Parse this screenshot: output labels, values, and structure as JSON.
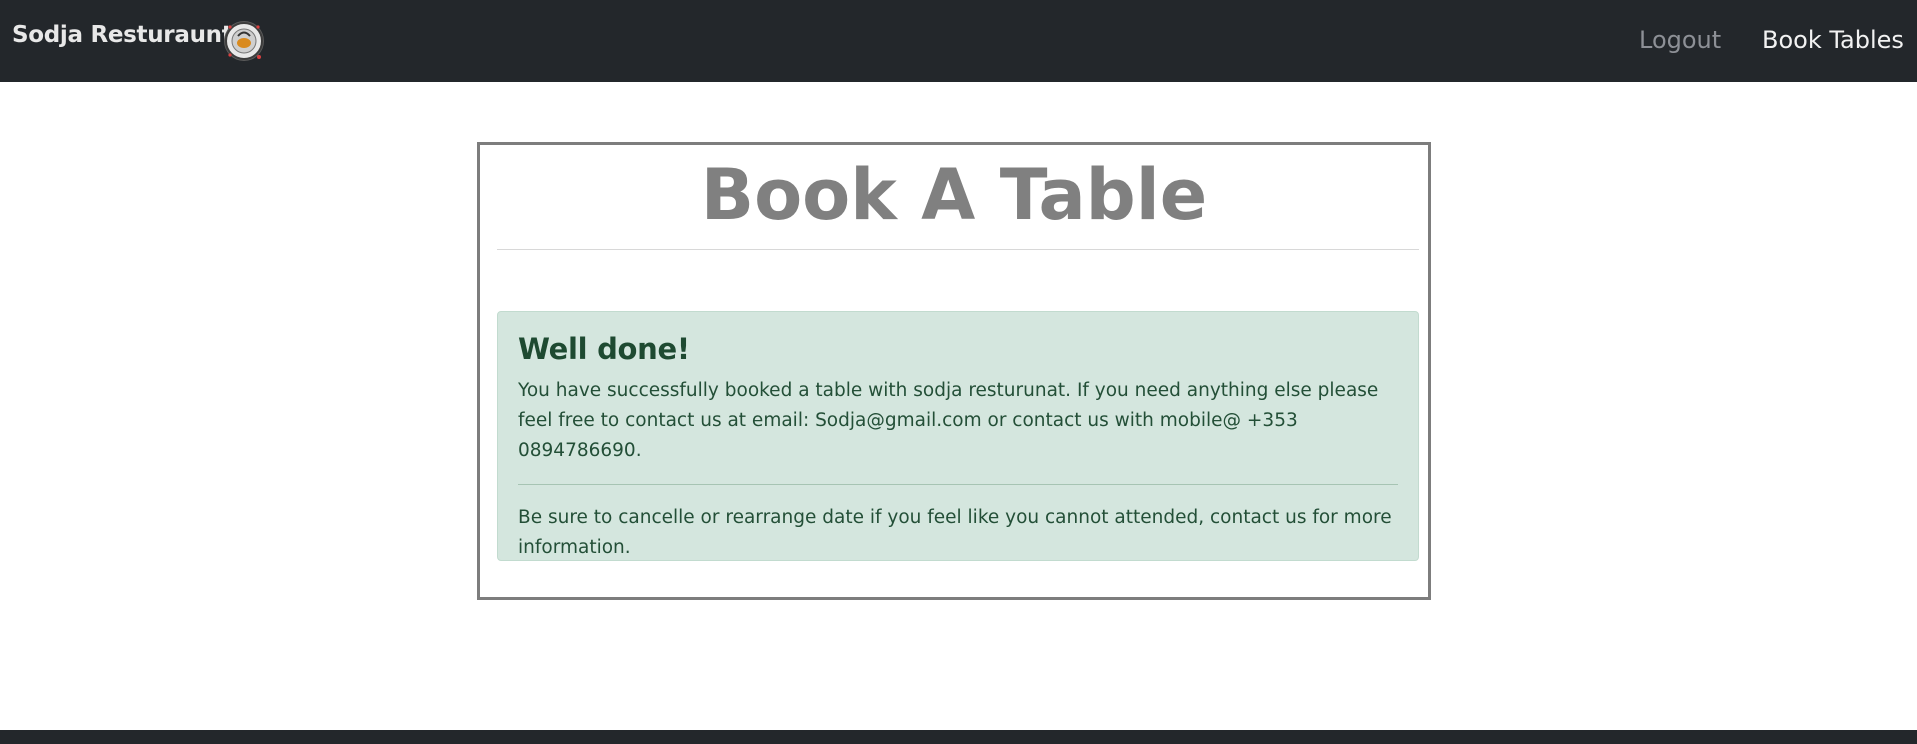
{
  "navbar": {
    "brand": "Sodja Resturaunt",
    "logo_icon": "restaurant-plate-logo",
    "links": [
      {
        "label": "Logout"
      },
      {
        "label": "Book Tables"
      }
    ]
  },
  "main": {
    "title": "Book A Table",
    "alert": {
      "heading": "Well done!",
      "message": "You have successfully booked a table with sodja resturunat. If you need anything else please feel free to contact us at email: Sodja@gmail.com or contact us with mobile@ +353 0894786690.",
      "note": "Be sure to cancelle or rearrange date if you feel like you cannot attended, contact us for more information."
    }
  },
  "colors": {
    "navbar_bg": "#23272b",
    "alert_bg": "#d4e6de",
    "title_color": "#808080"
  }
}
